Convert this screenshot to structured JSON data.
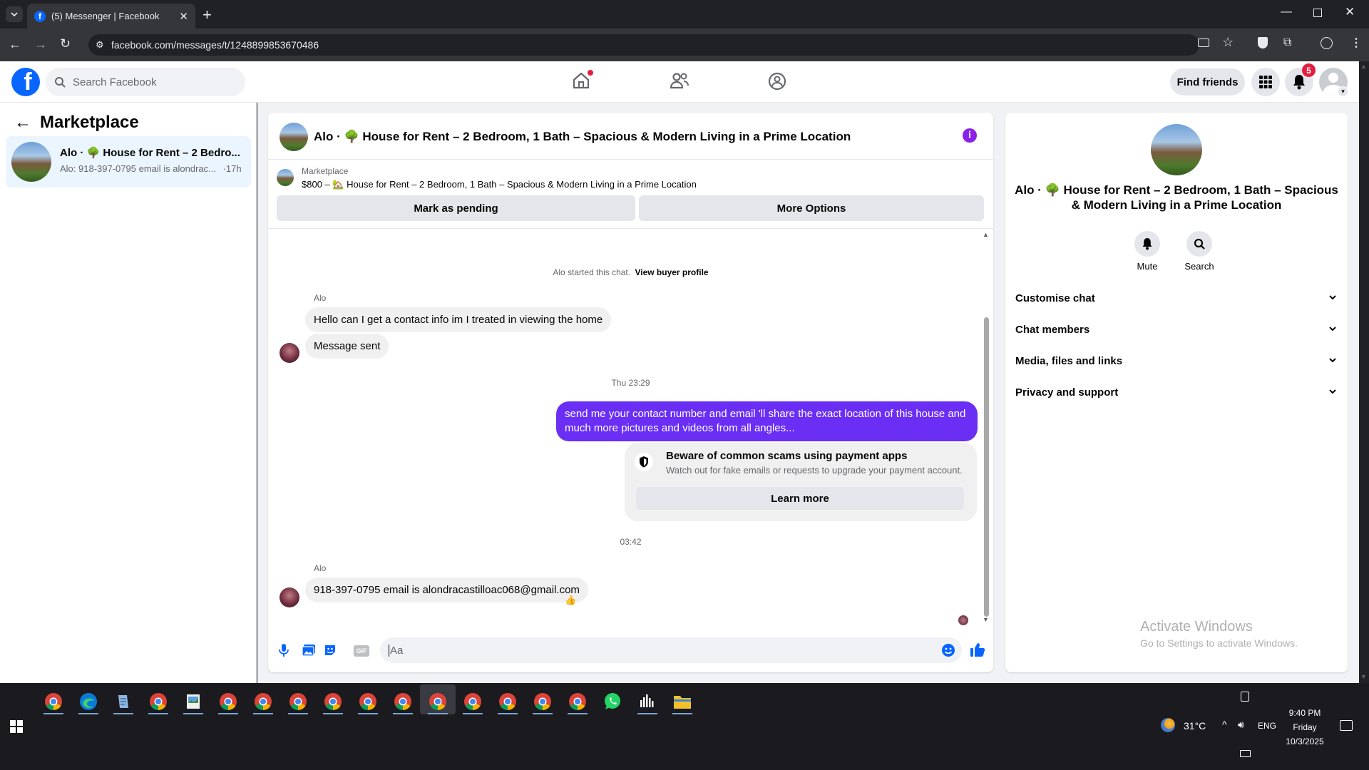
{
  "browser": {
    "tab_title": "(5) Messenger | Facebook",
    "url": "facebook.com/messages/t/1248899853670486"
  },
  "fb": {
    "search_placeholder": "Search Facebook",
    "find_friends": "Find friends",
    "notification_count": "5"
  },
  "sidebar": {
    "title": "Marketplace",
    "conversation": {
      "title": "Alo · 🌳 House for Rent – 2 Bedro...",
      "preview": "Alo: 918-397-0795 email is alondrac...",
      "time": "·17h"
    }
  },
  "chat": {
    "header_title": "Alo · 🌳 House for Rent – 2 Bedroom, 1 Bath – Spacious & Modern Living in a Prime Location",
    "listing_label": "Marketplace",
    "listing_detail": "$800 – 🏡 House for Rent – 2 Bedroom, 1 Bath – Spacious & Modern Living in a Prime Location",
    "mark_pending": "Mark as pending",
    "more_options": "More Options",
    "started_text": "Alo started this chat.",
    "view_buyer": "View buyer profile",
    "sender_name_1": "Alo",
    "msg1": "Hello can I get a contact info im I treated in viewing the home",
    "msg2": "Message sent",
    "timestamp1": "Thu 23:29",
    "my_msg_line1": "send me your contact number and email 'll share the exact location of this house and",
    "my_msg_line2": "much more pictures and videos from all angles...",
    "scam_title": "Beware of common scams using payment apps",
    "scam_body": "Watch out for fake emails or requests to upgrade your payment account.",
    "learn_more": "Learn more",
    "timestamp2": "03:42",
    "sender_name_2": "Alo",
    "msg3": "918-397-0795 email is alondracastilloac068@gmail.com",
    "reaction": "👍",
    "composer_placeholder": "Aa"
  },
  "info": {
    "title_line1": "Alo · 🌳 House for Rent – 2 Bedroom, 1 Bath – Spacious",
    "title_line2": "& Modern Living in a Prime Location",
    "mute": "Mute",
    "search": "Search",
    "sections": [
      "Customise chat",
      "Chat members",
      "Media, files and links",
      "Privacy and support"
    ],
    "watermark_title": "Activate Windows",
    "watermark_sub": "Go to Settings to activate Windows."
  },
  "taskbar": {
    "temperature": "31°C",
    "language": "ENG",
    "time": "9:40 PM",
    "day": "Friday",
    "date": "10/3/2025"
  },
  "colors": {
    "fb_blue": "#0866ff",
    "my_bubble": "#6a2ef5",
    "info_purple": "#8a21e8",
    "notif_red": "#e41e3f"
  }
}
